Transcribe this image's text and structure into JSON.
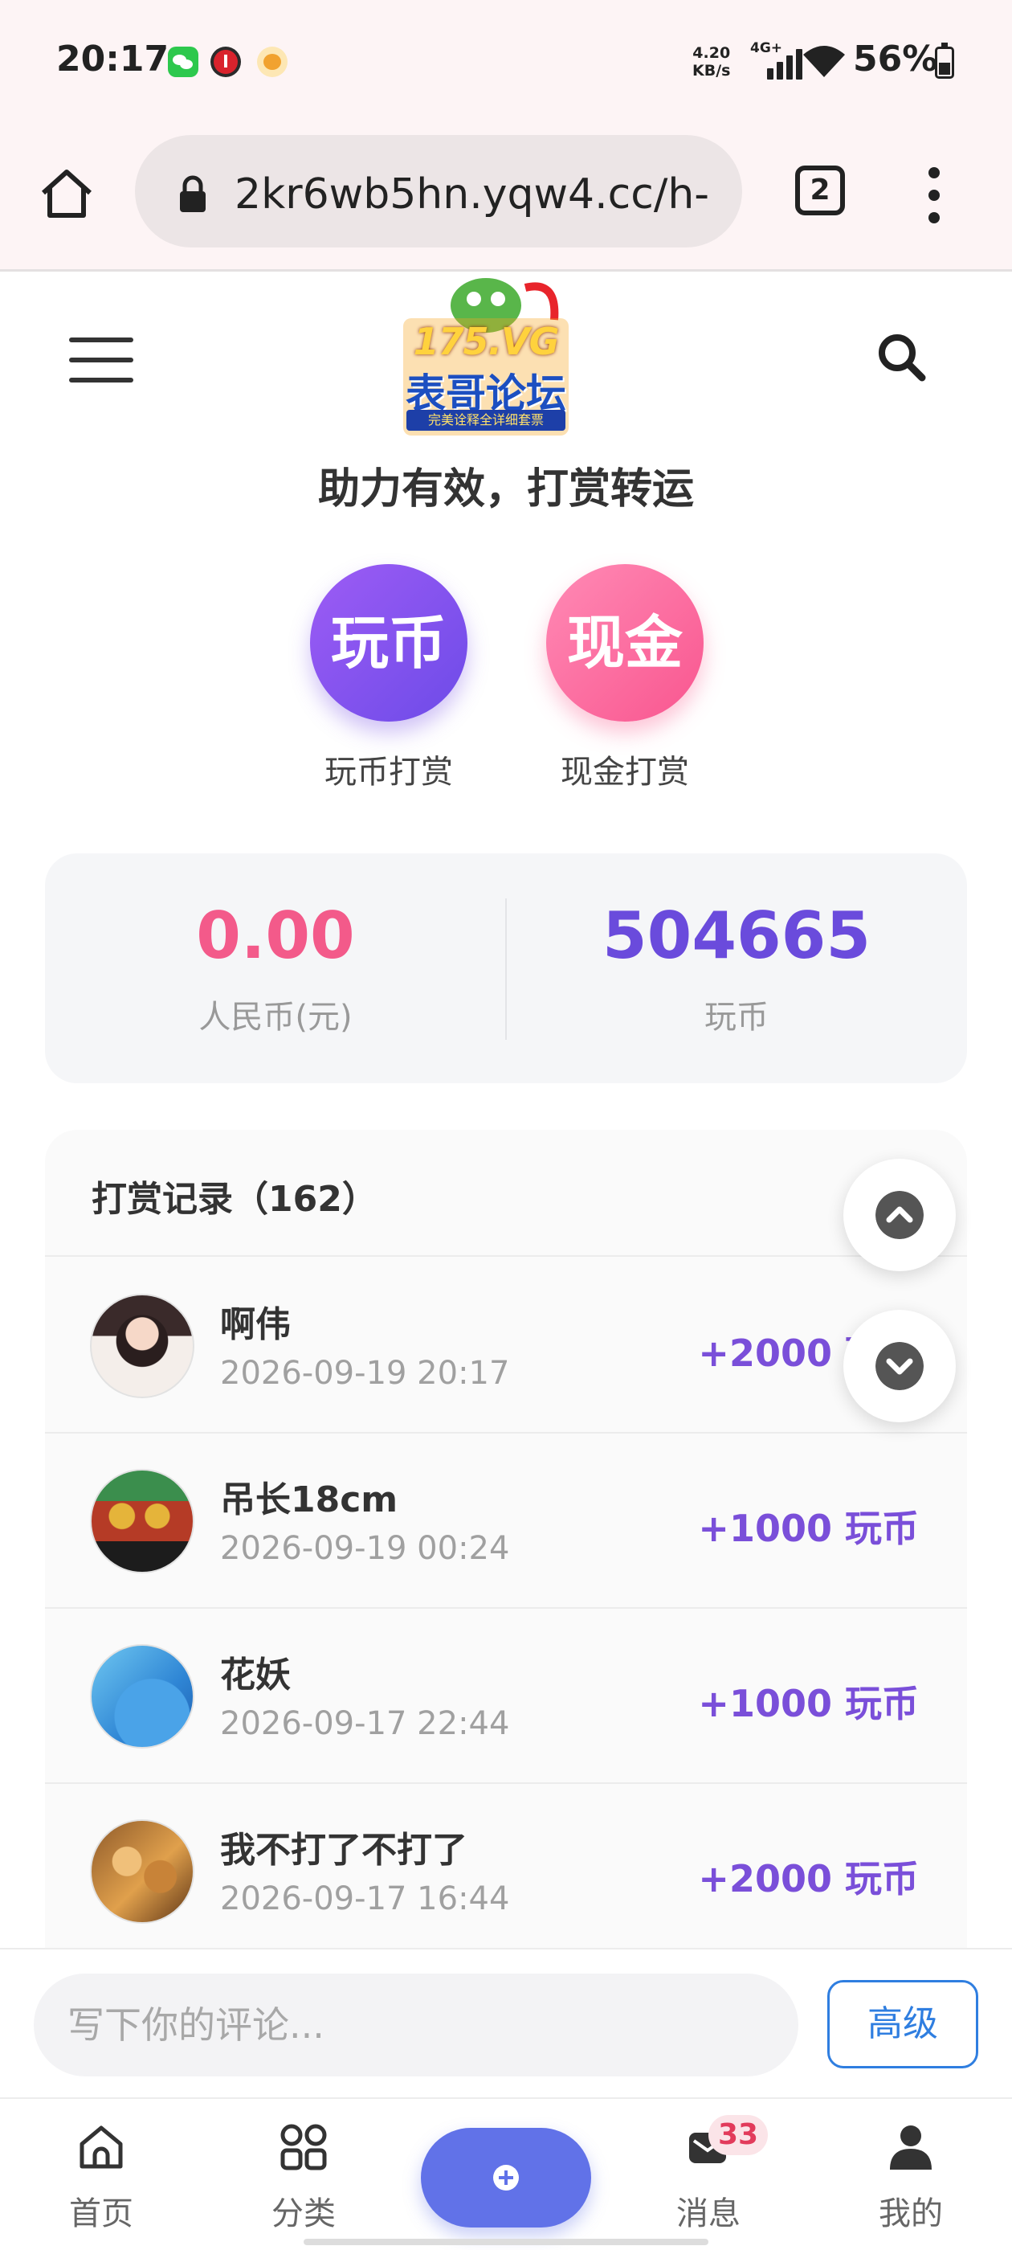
{
  "status_bar": {
    "time": "20:17",
    "net_speed_value": "4.20",
    "net_speed_unit": "KB/s",
    "network": "4G+",
    "battery": "56%",
    "app_icons": [
      "wechat-icon",
      "red-app-icon",
      "cat-app-icon"
    ]
  },
  "browser": {
    "url": "2kr6wb5hn.yqw4.cc/h-",
    "tab_count": "2"
  },
  "header": {
    "logo_title": "175.VG",
    "logo_subtitle": "表哥论坛",
    "logo_band": "完美诠释全详细套票"
  },
  "slogan": "助力有效，打赏转运",
  "reward_options": [
    {
      "circle_text": "玩币",
      "label": "玩币打赏",
      "color": "#7b52ee"
    },
    {
      "circle_text": "现金",
      "label": "现金打赏",
      "color": "#f9568f"
    }
  ],
  "balance": {
    "rmb_value": "0.00",
    "rmb_label": "人民币(元)",
    "coin_value": "504665",
    "coin_label": "玩币"
  },
  "records": {
    "title": "打赏记录（162）",
    "items": [
      {
        "name": "啊伟",
        "time": "2026-09-19 20:17",
        "amount": "+2000 玩币"
      },
      {
        "name": "吊长18cm",
        "time": "2026-09-19 00:24",
        "amount": "+1000 玩币"
      },
      {
        "name": "花妖",
        "time": "2026-09-17 22:44",
        "amount": "+1000 玩币"
      },
      {
        "name": "我不打了不打了",
        "time": "2026-09-17 16:44",
        "amount": "+2000 玩币"
      }
    ]
  },
  "comment": {
    "placeholder": "写下你的评论...",
    "advanced_label": "高级"
  },
  "nav": {
    "home": "首页",
    "category": "分类",
    "messages": "消息",
    "messages_badge": "33",
    "profile": "我的"
  },
  "colors": {
    "accent_purple": "#6a4bdc",
    "accent_pink": "#f35a8a",
    "link_blue": "#2f7ee0",
    "post_button": "#6172e8"
  }
}
